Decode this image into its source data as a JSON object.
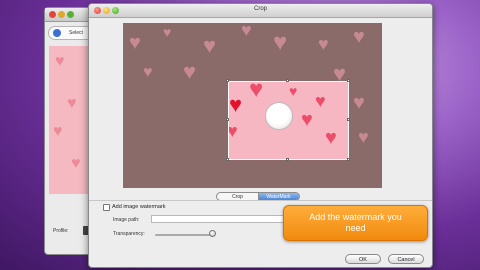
{
  "background_window": {
    "toolbar_label": "Select",
    "profile_label": "Profile:"
  },
  "dialog": {
    "title": "Crop",
    "tabs": [
      {
        "label": "Crop",
        "selected": false
      },
      {
        "label": "WaterMark",
        "selected": true
      }
    ],
    "watermark": {
      "checkbox_label": "Add image watermark",
      "checked": false,
      "image_path_label": "Image path:",
      "image_path_value": "",
      "transparency_label": "Transparency:",
      "transparency_level": 0.95
    },
    "ok_label": "OK",
    "cancel_label": "Cancel"
  },
  "callout": {
    "text": "Add the watermark you\nneed"
  },
  "colors": {
    "accent_orange": "#f29117",
    "selected_tab_blue": "#4b87d8",
    "preview_pink": "#f6b6c2",
    "heart_red": "#ee4d6a"
  },
  "icons": [
    "app-icon",
    "heart-icon",
    "pig-icon"
  ]
}
